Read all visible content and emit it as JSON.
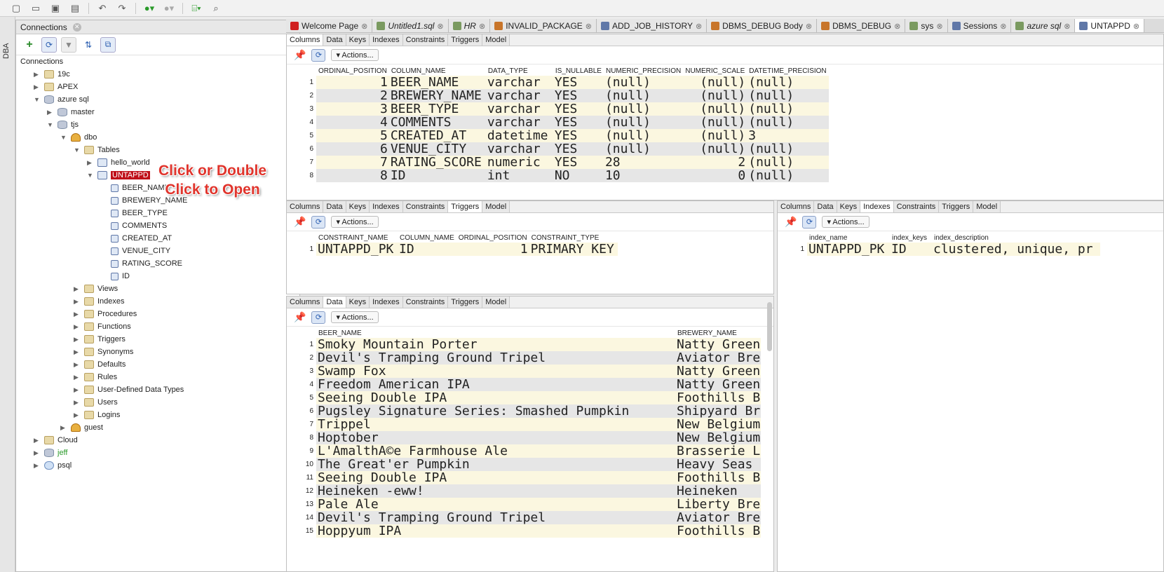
{
  "toolbar": {
    "icons": [
      "new-file-icon",
      "open-folder-icon",
      "save-icon",
      "save-all-icon",
      "undo-icon",
      "redo-icon",
      "run-icon",
      "debug-icon",
      "sql-worksheet-icon",
      "find-db-object-icon"
    ]
  },
  "dba_strip": {
    "label": "DBA"
  },
  "connections_panel": {
    "title": "Connections",
    "tree": [
      {
        "label": "Connections",
        "depth": 0,
        "icon": "connections-icon",
        "expand": ""
      },
      {
        "label": "19c",
        "depth": 1,
        "icon": "folder-icon",
        "expand": "▶"
      },
      {
        "label": "APEX",
        "depth": 1,
        "icon": "folder-icon",
        "expand": "▶"
      },
      {
        "label": "azure sql",
        "depth": 1,
        "icon": "connection-icon",
        "expand": "▼"
      },
      {
        "label": "master",
        "depth": 2,
        "icon": "database-icon",
        "expand": "▶"
      },
      {
        "label": "tjs",
        "depth": 2,
        "icon": "database-icon",
        "expand": "▼"
      },
      {
        "label": "dbo",
        "depth": 3,
        "icon": "schema-user-icon",
        "expand": "▼"
      },
      {
        "label": "Tables",
        "depth": 4,
        "icon": "folder-icon",
        "expand": "▼"
      },
      {
        "label": "hello_world",
        "depth": 5,
        "icon": "table-icon",
        "expand": "▶"
      },
      {
        "label": "UNTAPPD",
        "depth": 5,
        "icon": "table-icon",
        "expand": "▼",
        "selected": true
      },
      {
        "label": "BEER_NAME",
        "depth": 6,
        "icon": "column-icon",
        "expand": ""
      },
      {
        "label": "BREWERY_NAME",
        "depth": 6,
        "icon": "column-icon",
        "expand": ""
      },
      {
        "label": "BEER_TYPE",
        "depth": 6,
        "icon": "column-icon",
        "expand": ""
      },
      {
        "label": "COMMENTS",
        "depth": 6,
        "icon": "column-icon",
        "expand": ""
      },
      {
        "label": "CREATED_AT",
        "depth": 6,
        "icon": "column-icon",
        "expand": ""
      },
      {
        "label": "VENUE_CITY",
        "depth": 6,
        "icon": "column-icon",
        "expand": ""
      },
      {
        "label": "RATING_SCORE",
        "depth": 6,
        "icon": "column-icon",
        "expand": ""
      },
      {
        "label": "ID",
        "depth": 6,
        "icon": "column-icon",
        "expand": ""
      },
      {
        "label": "Views",
        "depth": 4,
        "icon": "folder-icon",
        "expand": "▶"
      },
      {
        "label": "Indexes",
        "depth": 4,
        "icon": "folder-icon",
        "expand": "▶"
      },
      {
        "label": "Procedures",
        "depth": 4,
        "icon": "folder-icon",
        "expand": "▶"
      },
      {
        "label": "Functions",
        "depth": 4,
        "icon": "folder-icon",
        "expand": "▶"
      },
      {
        "label": "Triggers",
        "depth": 4,
        "icon": "folder-icon",
        "expand": "▶"
      },
      {
        "label": "Synonyms",
        "depth": 4,
        "icon": "folder-icon",
        "expand": "▶"
      },
      {
        "label": "Defaults",
        "depth": 4,
        "icon": "folder-icon",
        "expand": "▶"
      },
      {
        "label": "Rules",
        "depth": 4,
        "icon": "folder-icon",
        "expand": "▶"
      },
      {
        "label": "User-Defined Data Types",
        "depth": 4,
        "icon": "folder-icon",
        "expand": "▶"
      },
      {
        "label": "Users",
        "depth": 4,
        "icon": "folder-icon",
        "expand": "▶"
      },
      {
        "label": "Logins",
        "depth": 4,
        "icon": "folder-icon",
        "expand": "▶"
      },
      {
        "label": "guest",
        "depth": 3,
        "icon": "schema-user-icon",
        "expand": "▶"
      },
      {
        "label": "Cloud",
        "depth": 1,
        "icon": "folder-icon",
        "expand": "▶"
      },
      {
        "label": "jeff",
        "depth": 1,
        "icon": "database-icon",
        "expand": "▶",
        "green": true
      },
      {
        "label": "psql",
        "depth": 1,
        "icon": "cloud-connection-icon",
        "expand": "▶"
      }
    ],
    "callout_line1": "Click or Double",
    "callout_line2": "Click to Open"
  },
  "doc_tabs": [
    {
      "label": "Welcome Page",
      "icon": "oracle-icon",
      "italic": false
    },
    {
      "label": "Untitled1.sql",
      "icon": "sql-file-icon",
      "italic": true
    },
    {
      "label": "HR",
      "icon": "sql-worksheet-icon",
      "italic": true
    },
    {
      "label": "INVALID_PACKAGE",
      "icon": "package-icon",
      "italic": false
    },
    {
      "label": "ADD_JOB_HISTORY",
      "icon": "procedure-icon",
      "italic": false
    },
    {
      "label": "DBMS_DEBUG Body",
      "icon": "package-body-icon",
      "italic": false
    },
    {
      "label": "DBMS_DEBUG",
      "icon": "package-icon",
      "italic": false
    },
    {
      "label": "sys",
      "icon": "sql-worksheet-icon",
      "italic": false
    },
    {
      "label": "Sessions",
      "icon": "report-icon",
      "italic": false
    },
    {
      "label": "azure sql",
      "icon": "sql-worksheet-icon",
      "italic": true
    },
    {
      "label": "UNTAPPD",
      "icon": "table-icon",
      "italic": false,
      "active": true
    }
  ],
  "subtabs": [
    "Columns",
    "Data",
    "Keys",
    "Indexes",
    "Constraints",
    "Triggers",
    "Model"
  ],
  "actions_label": "Actions...",
  "columns_grid": {
    "headers": [
      "ORDINAL_POSITION",
      "COLUMN_NAME",
      "DATA_TYPE",
      "IS_NULLABLE",
      "NUMERIC_PRECISION",
      "NUMERIC_SCALE",
      "DATETIME_PRECISION"
    ],
    "rows": [
      [
        "1",
        "1",
        "BEER_NAME",
        "varchar",
        "YES",
        "(null)",
        "(null)",
        "(null)"
      ],
      [
        "2",
        "2",
        "BREWERY_NAME",
        "varchar",
        "YES",
        "(null)",
        "(null)",
        "(null)"
      ],
      [
        "3",
        "3",
        "BEER_TYPE",
        "varchar",
        "YES",
        "(null)",
        "(null)",
        "(null)"
      ],
      [
        "4",
        "4",
        "COMMENTS",
        "varchar",
        "YES",
        "(null)",
        "(null)",
        "(null)"
      ],
      [
        "5",
        "5",
        "CREATED_AT",
        "datetime",
        "YES",
        "(null)",
        "(null)",
        "3"
      ],
      [
        "6",
        "6",
        "VENUE_CITY",
        "varchar",
        "YES",
        "(null)",
        "(null)",
        "(null)"
      ],
      [
        "7",
        "7",
        "RATING_SCORE",
        "numeric",
        "YES",
        "28",
        "2",
        "(null)"
      ],
      [
        "8",
        "8",
        "ID",
        "int",
        "NO",
        "10",
        "0",
        "(null)"
      ]
    ]
  },
  "constraints_grid": {
    "headers": [
      "CONSTRAINT_NAME",
      "COLUMN_NAME",
      "ORDINAL_POSITION",
      "CONSTRAINT_TYPE"
    ],
    "rows": [
      [
        "1",
        "UNTAPPD_PK",
        "ID",
        "1",
        "PRIMARY KEY"
      ]
    ]
  },
  "indexes_grid": {
    "headers": [
      "index_name",
      "index_keys",
      "index_description"
    ],
    "rows": [
      [
        "1",
        "UNTAPPD_PK",
        "ID",
        "clustered, unique, pr"
      ]
    ]
  },
  "data_grid": {
    "headers": [
      "BEER_NAME",
      "BREWERY_NAME"
    ],
    "rows": [
      [
        "1",
        "Smoky Mountain Porter",
        "Natty Green"
      ],
      [
        "2",
        "Devil's Tramping Ground Tripel",
        "Aviator Bre"
      ],
      [
        "3",
        "Swamp Fox",
        "Natty Green"
      ],
      [
        "4",
        "Freedom American IPA",
        "Natty Green"
      ],
      [
        "5",
        "Seeing Double IPA",
        "Foothills B"
      ],
      [
        "6",
        "Pugsley Signature Series: Smashed Pumpkin",
        "Shipyard Br"
      ],
      [
        "7",
        "Trippel",
        "New Belgium"
      ],
      [
        "8",
        "Hoptober",
        "New Belgium"
      ],
      [
        "9",
        "L'AmalthA©e Farmhouse Ale",
        "Brasserie L"
      ],
      [
        "10",
        "The Great'er Pumpkin",
        "Heavy Seas"
      ],
      [
        "11",
        "Seeing Double IPA",
        "Foothills B"
      ],
      [
        "12",
        "Heineken -eww!",
        "Heineken"
      ],
      [
        "13",
        "Pale Ale",
        "Liberty Bre"
      ],
      [
        "14",
        "Devil's Tramping Ground Tripel",
        "Aviator Bre"
      ],
      [
        "15",
        "Hoppyum IPA",
        "Foothills B"
      ]
    ]
  }
}
